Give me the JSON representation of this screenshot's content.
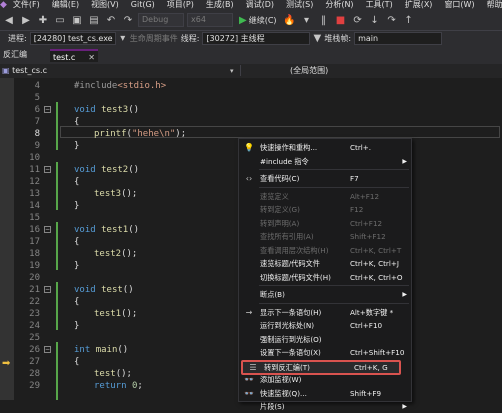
{
  "menubar": {
    "items": [
      "文件(F)",
      "编辑(E)",
      "视图(V)",
      "Git(G)",
      "项目(P)",
      "生成(B)",
      "调试(D)",
      "测试(S)",
      "分析(N)",
      "工具(T)",
      "扩展(X)",
      "窗口(W)",
      "帮助(H)"
    ]
  },
  "toolbar": {
    "config_combo": "Debug",
    "platform_combo": "x64",
    "continue_label": "继续(C)"
  },
  "procbar": {
    "process_label": "进程:",
    "process_value": "[24280] test_cs.exe",
    "lifecycle_label": "生命周期事件",
    "thread_label": "线程:",
    "thread_value": "[30272] 主线程",
    "stackframe_label": "堆栈帧:",
    "stackframe_value": "main"
  },
  "tabs": {
    "side_tab": "反汇编",
    "active_tab": "test.c"
  },
  "navbar": {
    "project": "test_cs.c",
    "scope": "(全局范围)"
  },
  "code": {
    "lines": [
      {
        "n": "4",
        "text": "#include<stdio.h>"
      },
      {
        "n": "5",
        "text": ""
      },
      {
        "n": "6",
        "text": "void test3()"
      },
      {
        "n": "7",
        "text": "{"
      },
      {
        "n": "8",
        "text": "printf(\"hehe\\n\");"
      },
      {
        "n": "9",
        "text": "}"
      },
      {
        "n": "10",
        "text": ""
      },
      {
        "n": "11",
        "text": "void test2()"
      },
      {
        "n": "12",
        "text": "{"
      },
      {
        "n": "13",
        "text": "test3();"
      },
      {
        "n": "14",
        "text": "}"
      },
      {
        "n": "15",
        "text": ""
      },
      {
        "n": "16",
        "text": "void test1()"
      },
      {
        "n": "17",
        "text": "{"
      },
      {
        "n": "18",
        "text": "test2();"
      },
      {
        "n": "19",
        "text": "}"
      },
      {
        "n": "20",
        "text": ""
      },
      {
        "n": "21",
        "text": "void test()"
      },
      {
        "n": "22",
        "text": "{"
      },
      {
        "n": "23",
        "text": "test1();"
      },
      {
        "n": "24",
        "text": "}"
      },
      {
        "n": "25",
        "text": ""
      },
      {
        "n": "26",
        "text": "int main()"
      },
      {
        "n": "27",
        "text": "{"
      },
      {
        "n": "28",
        "text": "test();"
      },
      {
        "n": "29",
        "text": "return 0;"
      }
    ]
  },
  "context_menu": {
    "items": [
      {
        "icon": "lightbulb-icon",
        "label": "快速操作和重构...",
        "shortcut": "Ctrl+.",
        "disabled": false
      },
      {
        "icon": "",
        "label": "#include 指令",
        "shortcut": "",
        "disabled": false,
        "submenu": true
      },
      {
        "icon": "code-icon",
        "label": "查看代码(C)",
        "shortcut": "F7",
        "disabled": false
      },
      {
        "icon": "",
        "label": "速览定义",
        "shortcut": "Alt+F12",
        "disabled": true
      },
      {
        "icon": "",
        "label": "转到定义(G)",
        "shortcut": "F12",
        "disabled": true
      },
      {
        "icon": "",
        "label": "转到声明(A)",
        "shortcut": "Ctrl+F12",
        "disabled": true
      },
      {
        "icon": "",
        "label": "查找所有引用(A)",
        "shortcut": "Shift+F12",
        "disabled": true
      },
      {
        "icon": "",
        "label": "查看调用层次结构(H)",
        "shortcut": "Ctrl+K, Ctrl+T",
        "disabled": true
      },
      {
        "icon": "",
        "label": "速览标题/代码文件",
        "shortcut": "Ctrl+K, Ctrl+J",
        "disabled": false
      },
      {
        "icon": "",
        "label": "切换标题/代码文件(H)",
        "shortcut": "Ctrl+K, Ctrl+O",
        "disabled": false
      },
      {
        "icon": "",
        "label": "断点(B)",
        "shortcut": "",
        "disabled": false,
        "submenu": true
      },
      {
        "icon": "arrow-right-icon",
        "label": "显示下一条语句(H)",
        "shortcut": "Alt+数字键 *",
        "disabled": false
      },
      {
        "icon": "",
        "label": "运行到光标处(N)",
        "shortcut": "Ctrl+F10",
        "disabled": false
      },
      {
        "icon": "",
        "label": "强制运行到光标(O)",
        "shortcut": "",
        "disabled": false
      },
      {
        "icon": "",
        "label": "设置下一条语句(X)",
        "shortcut": "Ctrl+Shift+F10",
        "disabled": false
      },
      {
        "icon": "disassembly-icon",
        "label": "转到反汇编(T)",
        "shortcut": "Ctrl+K, G",
        "disabled": false,
        "highlighted": true
      },
      {
        "icon": "watch-icon",
        "label": "添加监视(W)",
        "shortcut": "",
        "disabled": false
      },
      {
        "icon": "quickwatch-icon",
        "label": "快速监视(Q)...",
        "shortcut": "Shift+F9",
        "disabled": false
      },
      {
        "icon": "",
        "label": "片段(S)",
        "shortcut": "",
        "disabled": false,
        "submenu": true
      }
    ]
  }
}
